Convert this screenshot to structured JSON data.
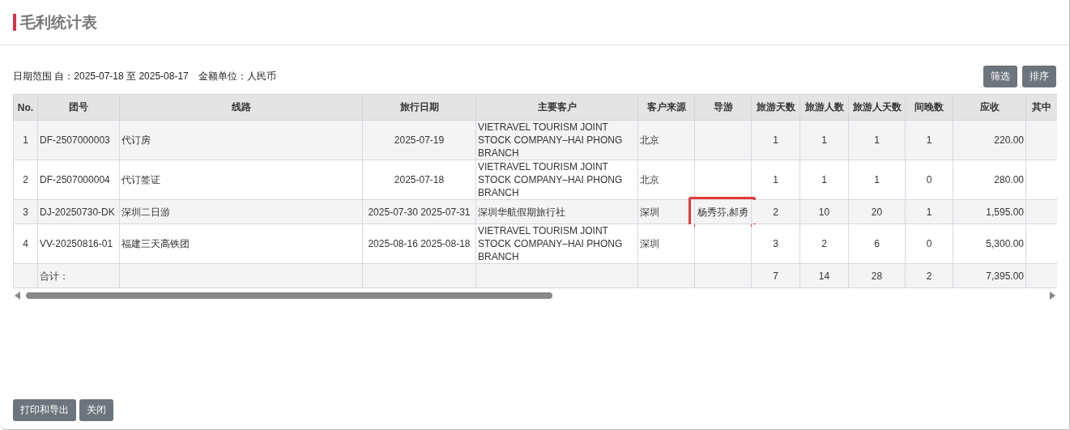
{
  "title": "毛利统计表",
  "info": "日期范围 自：2025-07-18 至 2025-08-17　金额单位：人民币",
  "toolbar_buttons": [
    "筛选",
    "排序"
  ],
  "columns": [
    "No.",
    "团号",
    "线路",
    "旅行日期",
    "主要客户",
    "客户来源",
    "导游",
    "旅游天数",
    "旅游人数",
    "旅游人天数",
    "间晚数",
    "应收",
    "其中"
  ],
  "rows": [
    {
      "no": "1",
      "group_no": "DF-2507000003",
      "route": "代订房",
      "travel_date": "2025-07-19",
      "customer": "VIETRAVEL TOURISM JOINT STOCK COMPANY–HAI PHONG BRANCH",
      "source": "北京",
      "days": "1",
      "people": "1",
      "person_days": "1",
      "nights": "1",
      "receivable": "220.00",
      "guide_highlighted": false
    },
    {
      "no": "2",
      "group_no": "DF-2507000004",
      "route": "代订签证",
      "travel_date": "2025-07-18",
      "customer": "VIETRAVEL TOURISM JOINT STOCK COMPANY–HAI PHONG BRANCH",
      "source": "北京",
      "days": "1",
      "people": "1",
      "person_days": "1",
      "nights": "0",
      "receivable": "280.00",
      "guide_highlighted": false
    },
    {
      "no": "3",
      "group_no": "DJ-20250730-DK",
      "route": "深圳二日游",
      "travel_date": "2025-07-30 2025-07-31",
      "customer": "深圳华航假期旅行社",
      "source": "深圳",
      "guide": "杨秀芬,郝勇",
      "days": "2",
      "people": "10",
      "person_days": "20",
      "nights": "1",
      "receivable": "1,595.00",
      "guide_highlighted": true
    },
    {
      "no": "4",
      "group_no": "VV-20250816-01",
      "route": "福建三天高铁团",
      "travel_date": "2025-08-16 2025-08-18",
      "customer": "VIETRAVEL TOURISM JOINT STOCK COMPANY–HAI PHONG BRANCH",
      "source": "深圳",
      "days": "3",
      "people": "2",
      "person_days": "6",
      "nights": "0",
      "receivable": "5,300.00",
      "guide_highlighted": false
    }
  ],
  "total": {
    "label": "合计：",
    "days": "7",
    "people": "14",
    "person_days": "28",
    "nights": "2",
    "receivable": "7,395.00"
  },
  "footer_buttons": [
    "打印和导出",
    "关闭"
  ]
}
